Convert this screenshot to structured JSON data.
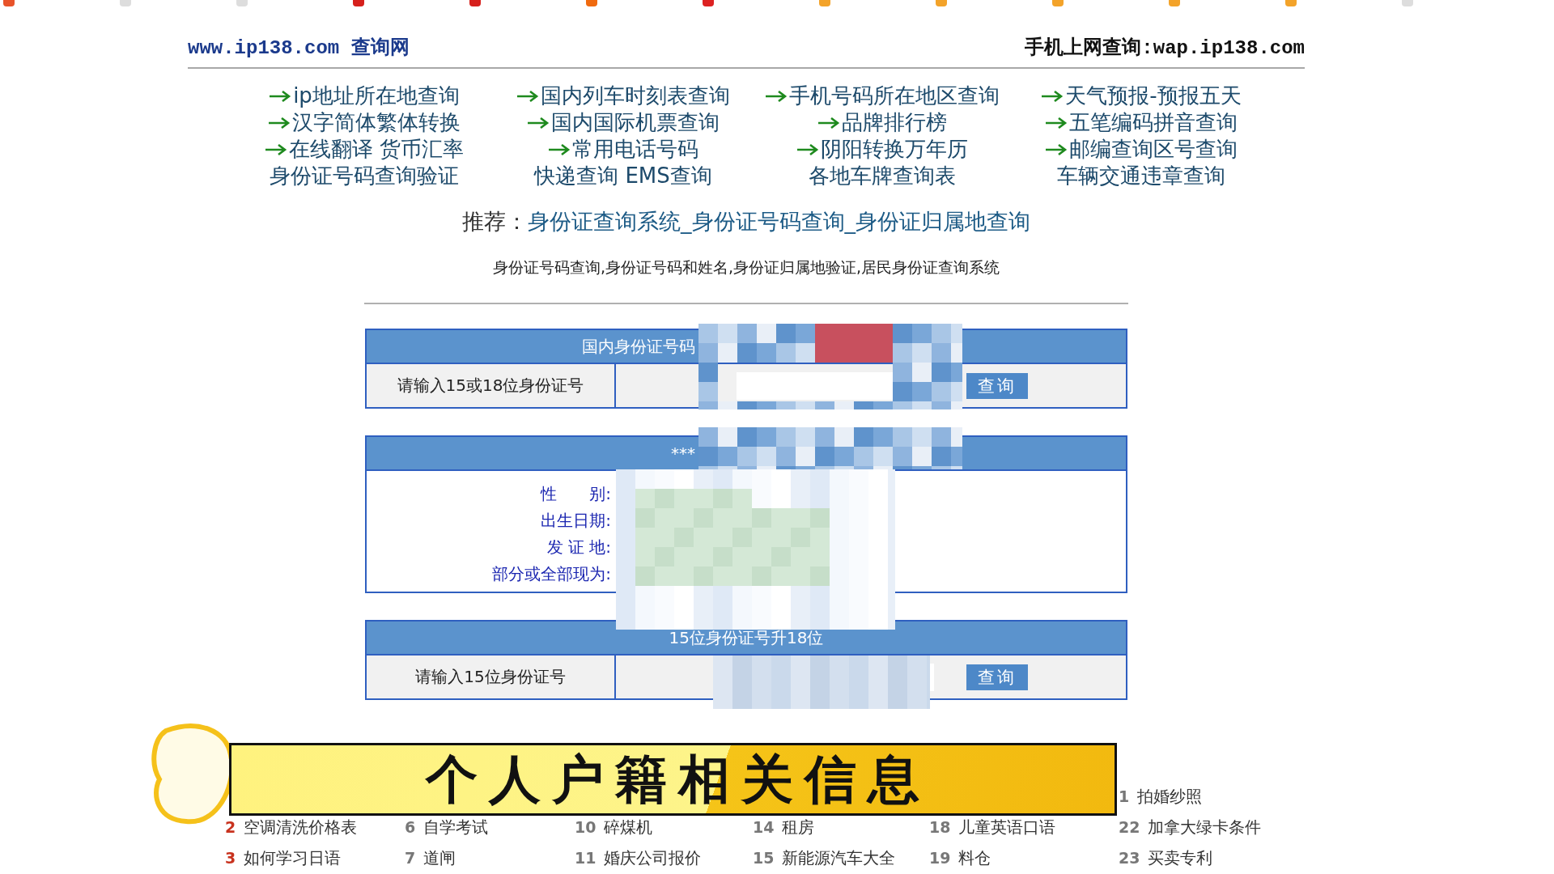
{
  "header": {
    "site": "www.ip138.com 查询网",
    "mobile": "手机上网查询:wap.ip138.com"
  },
  "links": [
    {
      "text": "ip地址所在地查询",
      "arrow": true
    },
    {
      "text": "国内列车时刻表查询",
      "arrow": true
    },
    {
      "text": "手机号码所在地区查询",
      "arrow": true
    },
    {
      "text": "天气预报-预报五天",
      "arrow": true
    },
    {
      "text": "汉字简体繁体转换",
      "arrow": true
    },
    {
      "text": "国内国际机票查询",
      "arrow": true
    },
    {
      "text": "品牌排行榜",
      "arrow": true
    },
    {
      "text": "五笔编码拼音查询",
      "arrow": true
    },
    {
      "text": "在线翻译 货币汇率",
      "arrow": true
    },
    {
      "text": "常用电话号码",
      "arrow": true
    },
    {
      "text": "阴阳转换万年历",
      "arrow": true
    },
    {
      "text": "邮编查询区号查询",
      "arrow": true
    },
    {
      "text": "身份证号码查询验证",
      "arrow": false
    },
    {
      "text": "快递查询 EMS查询",
      "arrow": false
    },
    {
      "text": "各地车牌查询表",
      "arrow": false
    },
    {
      "text": "车辆交通违章查询",
      "arrow": false
    }
  ],
  "recommend": {
    "label": "推荐：",
    "link": "身份证查询系统_身份证号码查询_身份证归属地查询"
  },
  "keywords": "身份证号码查询,身份证号码和姓名,身份证归属地验证,居民身份证查询系统",
  "id_query": {
    "title": "国内身份证号码",
    "label": "请输入15或18位身份证号",
    "button": "查询"
  },
  "result": {
    "title": "***",
    "fields": [
      "性　　别:",
      "出生日期:",
      "发 证 地:",
      "部分或全部现为:"
    ]
  },
  "upgrade": {
    "title": "15位身份证号升18位",
    "label": "请输入15位身份证号",
    "button": "查询"
  },
  "banner": {
    "title": "个人户籍相关信息"
  },
  "hot_columns": [
    [
      {
        "num": "2",
        "text": "空调清洗价格表",
        "hot": true
      },
      {
        "num": "3",
        "text": "如何学习日语",
        "hot": true
      }
    ],
    [
      {
        "num": "6",
        "text": "自学考试",
        "hot": false
      },
      {
        "num": "7",
        "text": "道闸",
        "hot": false
      }
    ],
    [
      {
        "num": "10",
        "text": "碎煤机",
        "hot": false
      },
      {
        "num": "11",
        "text": "婚庆公司报价",
        "hot": false
      }
    ],
    [
      {
        "num": "14",
        "text": "租房",
        "hot": false
      },
      {
        "num": "15",
        "text": "新能源汽车大全",
        "hot": false
      }
    ],
    [
      {
        "num": "18",
        "text": "儿童英语口语",
        "hot": false
      },
      {
        "num": "19",
        "text": "料仓",
        "hot": false
      }
    ],
    [
      {
        "num": "1",
        "text": "拍婚纱照",
        "hot": false
      },
      {
        "num": "22",
        "text": "加拿大绿卡条件",
        "hot": false
      },
      {
        "num": "23",
        "text": "买卖专利",
        "hot": false
      }
    ]
  ]
}
